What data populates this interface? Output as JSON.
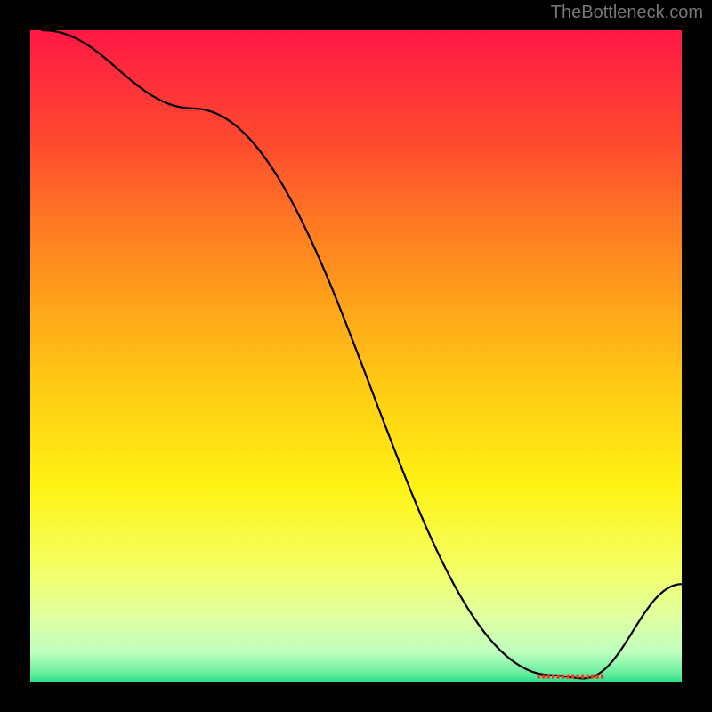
{
  "attribution": "TheBottleneck.com",
  "chart_data": {
    "type": "line",
    "title": "",
    "xlabel": "",
    "ylabel": "",
    "xlim": [
      0,
      100
    ],
    "ylim": [
      0,
      100
    ],
    "x": [
      0,
      2,
      25,
      80,
      85,
      100
    ],
    "values": [
      102,
      100,
      88,
      1,
      0.5,
      15
    ],
    "marker": {
      "x": 83,
      "y": 0.8,
      "label": ""
    },
    "background": "rainbow-vertical-gradient",
    "grid": false,
    "legend": false
  },
  "visual": {
    "line_color": "#000000",
    "line_width": 2.2,
    "marker_color": "#ff3020",
    "frame_color": "#000000",
    "frame_width": 8,
    "grad_stops": [
      {
        "pos": 0.0,
        "color": "#ff1744"
      },
      {
        "pos": 0.06,
        "color": "#ff2a3c"
      },
      {
        "pos": 0.18,
        "color": "#ff4d2e"
      },
      {
        "pos": 0.3,
        "color": "#ff7a22"
      },
      {
        "pos": 0.42,
        "color": "#ffa31a"
      },
      {
        "pos": 0.55,
        "color": "#ffcc14"
      },
      {
        "pos": 0.7,
        "color": "#fff314"
      },
      {
        "pos": 0.82,
        "color": "#f5ff60"
      },
      {
        "pos": 0.9,
        "color": "#e0ffa0"
      },
      {
        "pos": 0.955,
        "color": "#bfffc0"
      },
      {
        "pos": 0.985,
        "color": "#6cf0a0"
      },
      {
        "pos": 1.0,
        "color": "#2fe08b"
      }
    ]
  }
}
